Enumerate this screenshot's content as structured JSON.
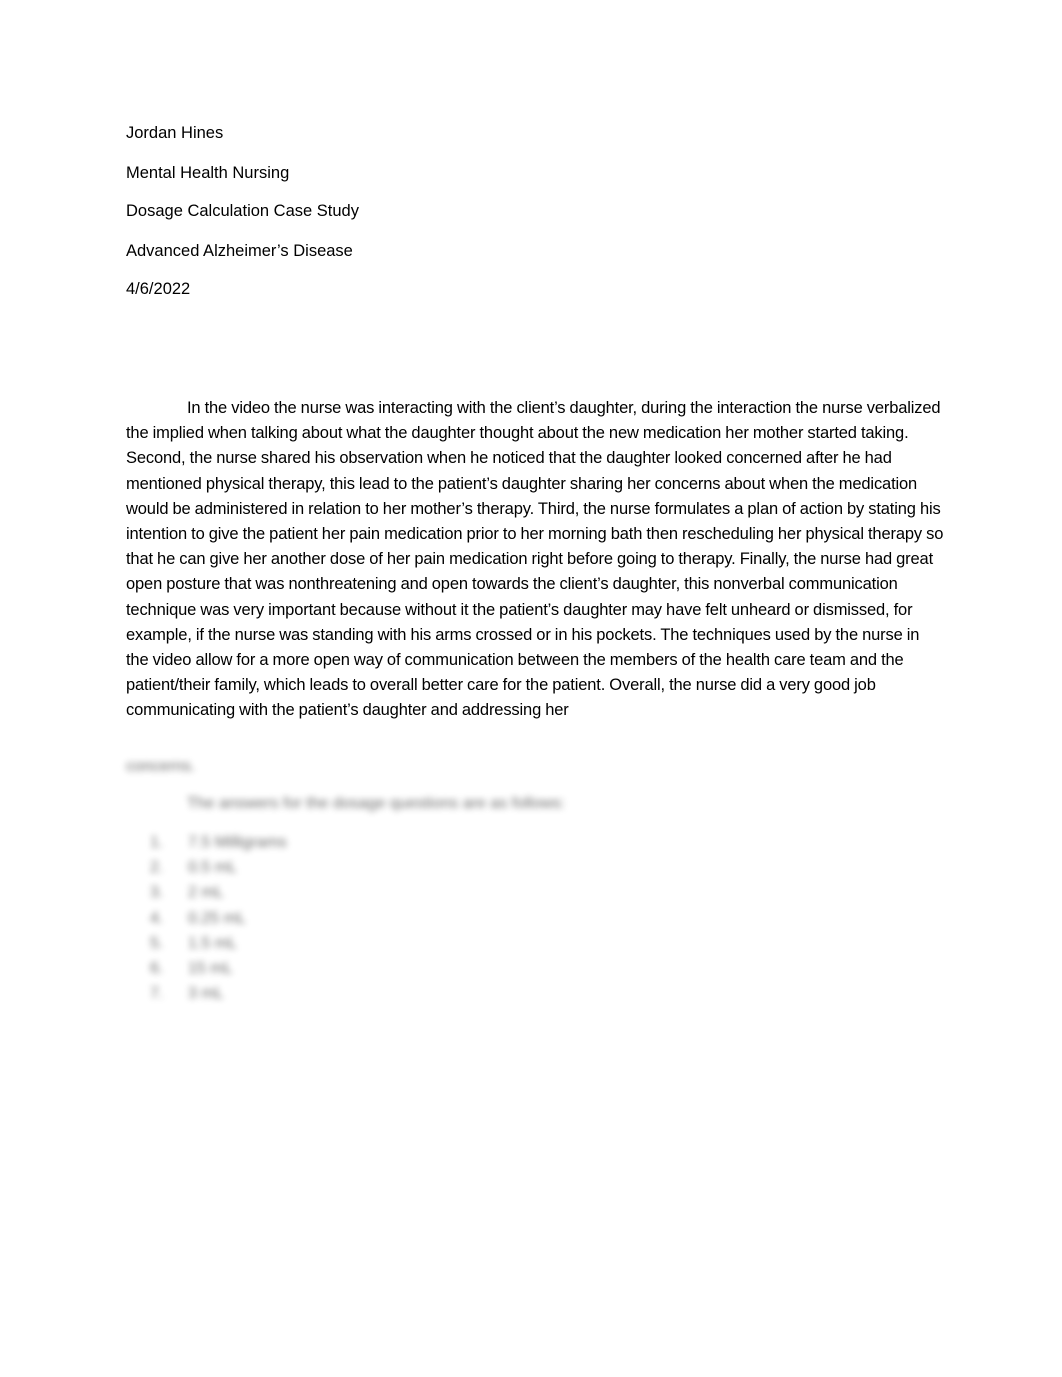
{
  "document": {
    "header": {
      "author": "Jordan Hines",
      "course": "Mental Health Nursing",
      "assignment": "Dosage Calculation Case Study",
      "topic": "Advanced Alzheimer’s Disease",
      "date": "4/6/2022"
    },
    "body_paragraph": "In the video the nurse was interacting with the client’s daughter, during the interaction the nurse verbalized the implied when talking about what the daughter thought about the new medication her mother started taking. Second, the nurse shared his observation when he noticed that the daughter looked concerned after he had mentioned physical therapy, this lead to the patient’s daughter sharing her concerns about when the medication would be administered in relation to her mother’s therapy. Third, the nurse formulates a plan of action by stating his intention to give the patient her pain medication prior to her morning bath then rescheduling her physical therapy so that he can give her another dose of her pain medication right before going to therapy. Finally, the nurse had great open posture that was nonthreatening and open towards the client’s daughter, this nonverbal communication technique was very important because without it the patient’s daughter may have felt unheard or dismissed, for example, if the nurse was standing with his arms crossed or in his pockets. The techniques used by the nurse in the video allow for a more open way of communication between the members of the health care team and the patient/their family, which leads to overall better care for the patient. Overall, the nurse did a very good job communicating with the patient’s daughter and addressing her",
    "blurred": {
      "paragraph_end": "concerns.",
      "answers_intro": "The answers for the dosage questions are as follows:",
      "answers": [
        {
          "num": "1.",
          "text": "7.5 Milligrams"
        },
        {
          "num": "2.",
          "text": "0.5 mL"
        },
        {
          "num": "3.",
          "text": "2 mL"
        },
        {
          "num": "4.",
          "text": "0.25 mL"
        },
        {
          "num": "5.",
          "text": "1.5 mL"
        },
        {
          "num": "6.",
          "text": "15 mL"
        },
        {
          "num": "7.",
          "text": "3 mL"
        }
      ]
    }
  }
}
